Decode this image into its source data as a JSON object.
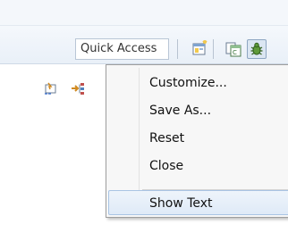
{
  "toolbar": {
    "quick_access_label": "Quick Access",
    "icons": [
      "open-perspective-icon",
      "resource-perspective-icon",
      "debug-perspective-icon"
    ]
  },
  "view_toolbar": {
    "icons": [
      "link-editor-icon",
      "hierarchy-icon"
    ]
  },
  "context_menu": {
    "items": [
      {
        "label": "Customize..."
      },
      {
        "label": "Save As..."
      },
      {
        "label": "Reset"
      },
      {
        "label": "Close"
      }
    ],
    "checked_item": {
      "label": "Show Text",
      "hovered": true
    }
  },
  "colors": {
    "toolbar_bg": "#eaf1f9",
    "menu_bg": "#f7f7f7",
    "hover_border": "#a9c4e4",
    "hover_bg": "#dfeaf7"
  }
}
